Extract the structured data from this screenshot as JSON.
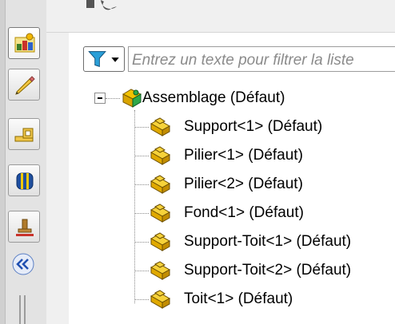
{
  "filter": {
    "placeholder": "Entrez un texte pour filtrer la liste"
  },
  "tree": {
    "root": {
      "label": "Assemblage (Défaut)",
      "icon": "assembly-icon"
    },
    "children": [
      {
        "label": "Support<1> (Défaut)",
        "icon": "part-icon"
      },
      {
        "label": "Pilier<1> (Défaut)",
        "icon": "part-icon"
      },
      {
        "label": "Pilier<2> (Défaut)",
        "icon": "part-icon"
      },
      {
        "label": "Fond<1> (Défaut)",
        "icon": "part-icon"
      },
      {
        "label": "Support-Toit<1> (Défaut)",
        "icon": "part-icon"
      },
      {
        "label": "Support-Toit<2> (Défaut)",
        "icon": "part-icon"
      },
      {
        "label": "Toit<1> (Défaut)",
        "icon": "part-icon"
      }
    ]
  },
  "toolbar": {
    "items": [
      {
        "icon": "scene-manager-icon"
      },
      {
        "icon": "pencil-icon"
      },
      {
        "icon": "measure-icon"
      },
      {
        "icon": "materials-icon"
      },
      {
        "icon": "stamp-icon"
      }
    ],
    "collapse_icon": "double-chevron-left-icon"
  },
  "colors": {
    "panel_bg": "#ffffff",
    "toolbar_bg": "#e3e3e3",
    "placeholder_text": "#8b8b8b",
    "part_icon_yellow": "#f2c200"
  }
}
